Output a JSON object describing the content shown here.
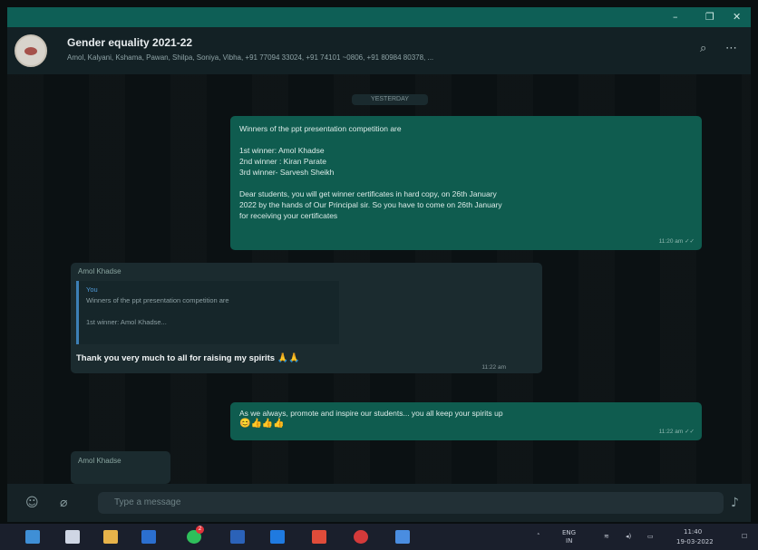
{
  "window": {
    "minimize": "–",
    "maximize": "❐",
    "close": "✕"
  },
  "header": {
    "title": "Gender equality 2021-22",
    "members": "Amol, Kalyani, Kshama, Pawan, Shilpa, Soniya, Vibha, +91 77094 33024, +91 74101 ~0806, +91 80984 80378, ..."
  },
  "chat": {
    "date": "YESTERDAY",
    "message1": {
      "lines": [
        "Winners of the ppt presentation competition are",
        "",
        "1st winner: Amol Khadse",
        "2nd winner : Kiran Parate",
        "3rd winner- Sarvesh Sheikh",
        "",
        "Dear students, you will get winner certificates in hard copy, on 26th January",
        "2022 by the hands of Our Principal sir. So you have to come on 26th January",
        "for receiving your certificates"
      ],
      "time": "11:20 am ✓✓"
    },
    "message2": {
      "sender": "Amol Khadse",
      "quote_author": "You",
      "quote_line1": "Winners of the ppt presentation competition are",
      "quote_line2": "1st winner: Amol Khadse...",
      "text": "Thank you very much to all for raising my spirits",
      "emoji": "🙏🙏",
      "time": "11:22 am"
    },
    "message3": {
      "text": "As we always, promote and inspire our students... you all keep your spirits up",
      "emoji": "😊👍👍👍",
      "time": "11:22 am ✓✓"
    },
    "partial_sender": "Amol Khadse"
  },
  "composer": {
    "placeholder": "Type a message"
  },
  "taskbar": {
    "lang": "ENG",
    "lang2": "IN",
    "time": "11:40",
    "date": "19-03-2022",
    "badge": "2"
  }
}
